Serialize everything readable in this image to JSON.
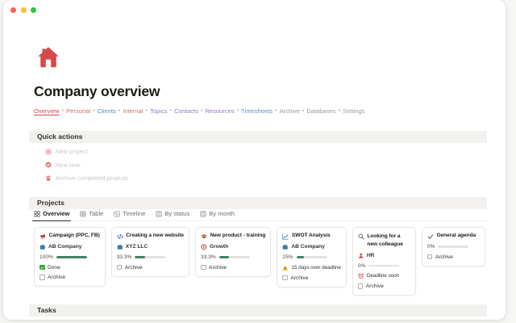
{
  "window": {
    "traffic_lights": {
      "close": "#ff5f57",
      "minimize": "#febc2e",
      "zoom": "#28c840"
    }
  },
  "page": {
    "icon": "home-icon",
    "title": "Company overview",
    "nav": {
      "separator": "•",
      "links": [
        {
          "label": "Overview",
          "color": "#d5484a",
          "active": true
        },
        {
          "label": "Personal",
          "color": "#c9766c"
        },
        {
          "label": "Clients",
          "color": "#4a94c6"
        },
        {
          "label": "Internal",
          "color": "#c9766c"
        },
        {
          "label": "Topics",
          "color": "#9477bd"
        },
        {
          "label": "Contacts",
          "color": "#8a7cc9"
        },
        {
          "label": "Resources",
          "color": "#9477bd"
        },
        {
          "label": "Timesheets",
          "color": "#5f8fc0"
        },
        {
          "label": "Archive",
          "color": "#9b9a97"
        },
        {
          "label": "Databases",
          "color": "#9b9a97"
        },
        {
          "label": "Settings",
          "color": "#9b9a97"
        }
      ]
    }
  },
  "quick_actions": {
    "heading": "Quick actions",
    "items": [
      {
        "icon": "plus-circle-icon",
        "label": "New project"
      },
      {
        "icon": "check-circle-icon",
        "label": "New task"
      },
      {
        "icon": "trash-icon",
        "label": "Archive completed projects"
      }
    ]
  },
  "projects": {
    "heading": "Projects",
    "tabs": [
      {
        "icon": "grid-icon",
        "label": "Overview",
        "active": true
      },
      {
        "icon": "table-icon",
        "label": "Table"
      },
      {
        "icon": "timeline-icon",
        "label": "Timeline"
      },
      {
        "icon": "board-icon",
        "label": "By status"
      },
      {
        "icon": "board-icon",
        "label": "By month"
      }
    ],
    "cards": [
      {
        "icon": "megaphone-icon",
        "title": "Campaign (PPC, FB)",
        "tag": {
          "icon": "briefcase-icon",
          "label": "AB Company"
        },
        "progress": {
          "label": "100%",
          "value": 100
        },
        "done_label": "Done",
        "archive_label": "Archive"
      },
      {
        "icon": "code-icon",
        "title": "Creating a new website",
        "tag": {
          "icon": "briefcase-icon",
          "label": "XYZ LLC"
        },
        "progress": {
          "label": "33.3%",
          "value": 33.3
        },
        "archive_label": "Archive"
      },
      {
        "icon": "graduation-cap-icon",
        "title": "New product - training",
        "tag": {
          "icon": "target-icon",
          "label": "Growth"
        },
        "progress": {
          "label": "33.3%",
          "value": 33.3
        },
        "archive_label": "Archive"
      },
      {
        "icon": "chart-increasing-icon",
        "title": "SWOT Analysis",
        "tag": {
          "icon": "briefcase-icon",
          "label": "AB Company"
        },
        "progress": {
          "label": "25%",
          "value": 25
        },
        "alert": {
          "icon": "warning-icon",
          "label": "15 days over deadline"
        },
        "archive_label": "Archive"
      },
      {
        "icon": "magnifier-icon",
        "title": "Looking for a new colleague",
        "tag": {
          "icon": "person-icon",
          "label": "HR"
        },
        "progress": {
          "label": "0%",
          "value": 0
        },
        "alert": {
          "icon": "alarm-clock-icon",
          "label": "Deadline soon"
        },
        "archive_label": "Archive"
      },
      {
        "icon": "check-icon",
        "title": "General agenda",
        "progress": {
          "label": "0%",
          "value": 0
        },
        "archive_label": "Archive"
      }
    ]
  },
  "tasks": {
    "heading": "Tasks"
  },
  "colors": {
    "accent_red": "#d5494b",
    "action_pink": "#e3807a",
    "progress_green": "#448361",
    "done_green": "#36a33c",
    "warning_yellow": "#f2b824",
    "briefcase_blue": "#337ea9",
    "section_bg": "#f2f1ee",
    "faded_text": "#c7c6c2"
  }
}
